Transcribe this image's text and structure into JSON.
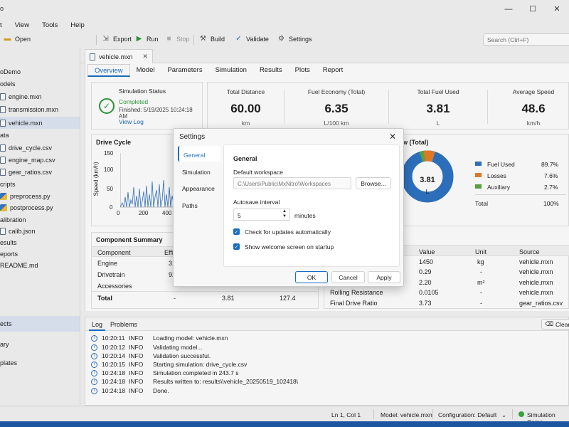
{
  "window": {
    "title": "o"
  },
  "menu": [
    "t",
    "View",
    "Tools",
    "Help"
  ],
  "toolbar": {
    "open": "Open",
    "export": "Export",
    "run": "Run",
    "stop": "Stop",
    "build": "Build",
    "validate": "Validate",
    "settings": "Settings",
    "search_placeholder": "Search (Ctrl+F)"
  },
  "sidebar": {
    "project": "oDemo",
    "models_folder": "odels",
    "models": [
      "engine.mxn",
      "transmission.mxn",
      "vehicle.mxn"
    ],
    "data_folder": "ata",
    "data": [
      "drive_cycle.csv",
      "engine_map.csv",
      "gear_ratios.csv"
    ],
    "scripts_folder": "cripts",
    "scripts": [
      "preprocess.py",
      "postprocess.py"
    ],
    "calibration_folder": "alibration",
    "calibration": [
      "calib.json"
    ],
    "results_folder": "esults",
    "reports_folder": "eports",
    "readme": "README.md",
    "bottom": [
      "ects",
      "ary",
      "plates"
    ]
  },
  "editor": {
    "file_tab": "vehicle.mxn",
    "tabs": [
      "Overview",
      "Model",
      "Parameters",
      "Simulation",
      "Results",
      "Plots",
      "Report"
    ],
    "status": {
      "title": "Simulation Status",
      "state": "Completed",
      "finished": "Finished: 5/19/2025 10:24:18 AM",
      "link": "View Log"
    },
    "stats": [
      {
        "title": "Total Distance",
        "value": "60.00",
        "unit": "km"
      },
      {
        "title": "Fuel Economy (Total)",
        "value": "6.35",
        "unit": "L/100 km"
      },
      {
        "title": "Total Fuel Used",
        "value": "3.81",
        "unit": "L"
      },
      {
        "title": "Average Speed",
        "value": "48.6",
        "unit": "km/h"
      }
    ],
    "drive_cycle": {
      "title": "Drive Cycle",
      "ylabel": "Speed (km/h)",
      "yticks": [
        "150",
        "100",
        "50",
        "0"
      ],
      "xticks": [
        "0",
        "200",
        "400"
      ]
    },
    "donut": {
      "title": "w (Total)",
      "center_value": "3.81",
      "center_unit": "L",
      "legend": [
        {
          "label": "Fuel Used",
          "value": "89.7%",
          "color": "#2f73c2"
        },
        {
          "label": "Losses",
          "value": "7.6%",
          "color": "#e87d27"
        },
        {
          "label": "Auxiliary",
          "value": "2.7%",
          "color": "#5aa845"
        }
      ],
      "total_label": "Total",
      "total_value": "100%"
    },
    "component_summary": {
      "title": "Component Summary",
      "headers": [
        "Component",
        "Effi"
      ],
      "rows": [
        [
          "Engine",
          "31"
        ],
        [
          "Drivetrain",
          "92"
        ],
        [
          "Accessories",
          ""
        ]
      ],
      "total": [
        "Total",
        "-",
        "3.81",
        "127.4"
      ]
    },
    "parameters": {
      "headers": [
        "Value",
        "Unit",
        "Source"
      ],
      "rows": [
        [
          "",
          "1450",
          "kg",
          "vehicle.mxn"
        ],
        [
          "",
          "0.29",
          "-",
          "vehicle.mxn"
        ],
        [
          "",
          "2.20",
          "m²",
          "vehicle.mxn"
        ],
        [
          "Rolling Resistance",
          "0.0105",
          "-",
          "vehicle.mxn"
        ],
        [
          "Final Drive Ratio",
          "3.73",
          "-",
          "gear_ratios.csv"
        ]
      ]
    }
  },
  "log": {
    "tabs": [
      "Log",
      "Problems"
    ],
    "clear": "Clear",
    "lines": [
      {
        "time": "10:20:11",
        "level": "INFO",
        "msg": "Loading model: vehicle.mxn"
      },
      {
        "time": "10:20:12",
        "level": "INFO",
        "msg": "Validating model..."
      },
      {
        "time": "10:20:14",
        "level": "INFO",
        "msg": "Validation successful."
      },
      {
        "time": "10:20:15",
        "level": "INFO",
        "msg": "Starting simulation: drive_cycle.csv"
      },
      {
        "time": "10:24:18",
        "level": "INFO",
        "msg": "Simulation completed in 243.7 s"
      },
      {
        "time": "10:24:18",
        "level": "INFO",
        "msg": "Results written to: results\\\\vehicle_20250519_102418\\"
      },
      {
        "time": "10:24:18",
        "level": "INFO",
        "msg": "Done."
      }
    ]
  },
  "statusbar": {
    "position": "Ln 1, Col 1",
    "model": "Model: vehicle.mxn",
    "config": "Configuration: Default",
    "sim": "Simulation Comp"
  },
  "dialog": {
    "title": "Settings",
    "nav": [
      "General",
      "Simulation",
      "Appearance",
      "Paths"
    ],
    "section": "General",
    "workspace_label": "Default workspace",
    "workspace_value": "C:\\Users\\Public\\MxNitro\\Workspaces",
    "browse": "Browse...",
    "autosave_label": "Autosave interval",
    "autosave_value": "5",
    "autosave_unit": "minutes",
    "check_updates": "Check for updates automatically",
    "welcome": "Show welcome screen on startup",
    "ok": "OK",
    "cancel": "Cancel",
    "apply": "Apply"
  }
}
